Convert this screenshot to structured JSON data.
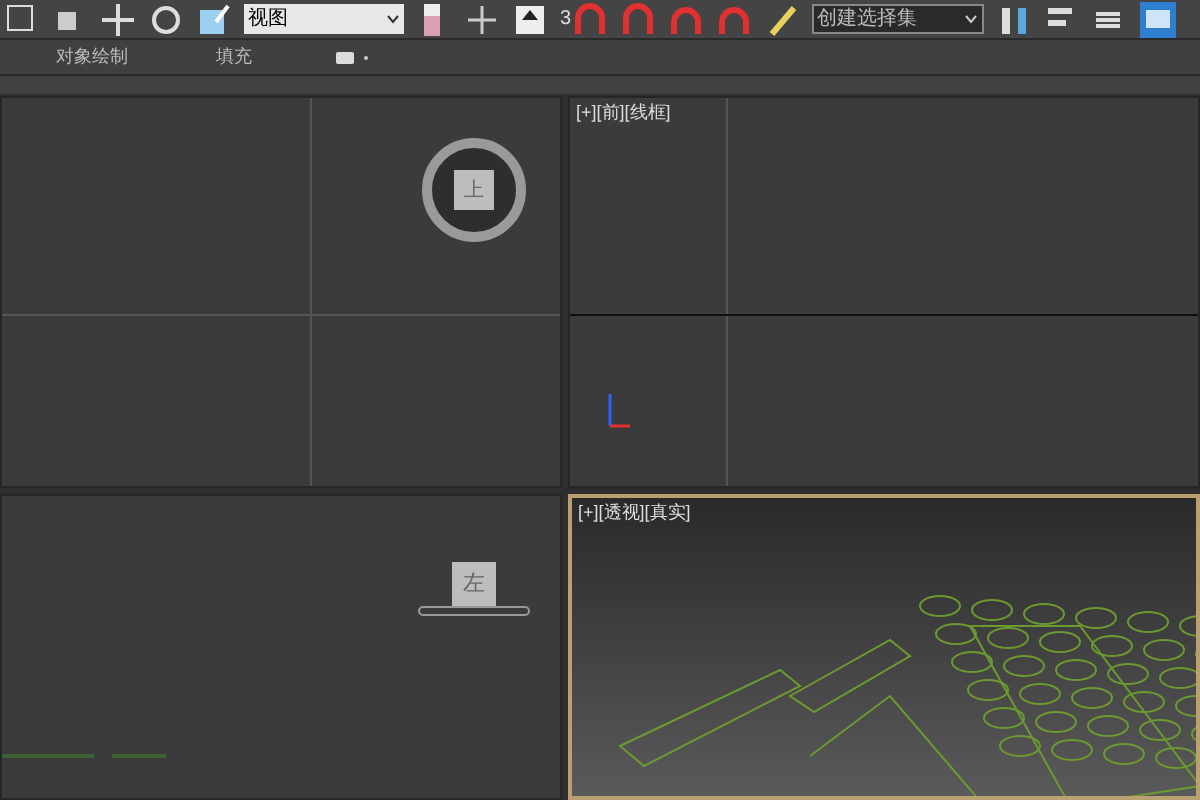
{
  "toolbar": {
    "view_dropdown": {
      "value": "视图"
    },
    "selection_set_dropdown": {
      "value": "创建选择集"
    },
    "snap_label": "3"
  },
  "ribbon": {
    "tabs": [
      {
        "label": "对象绘制",
        "selected": false
      },
      {
        "label": "填充",
        "selected": false
      }
    ]
  },
  "viewports": [
    {
      "active": false,
      "viewcube": "上"
    },
    {
      "labels": [
        "[+]",
        "[前]",
        "[线框]"
      ],
      "active": false
    },
    {
      "active": false,
      "viewcube": "左"
    },
    {
      "labels": [
        "[+]",
        "[透视]",
        "[真实]"
      ],
      "active": true
    }
  ]
}
